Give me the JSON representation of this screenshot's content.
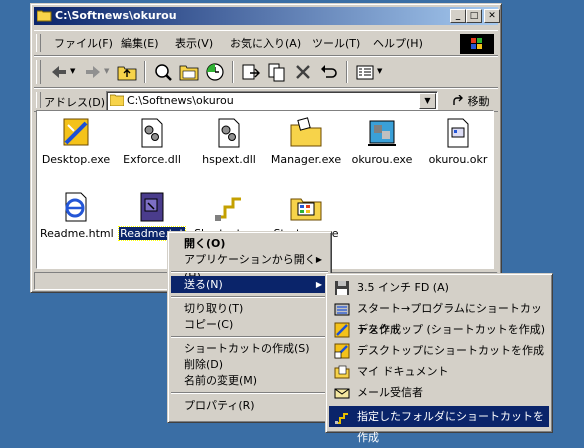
{
  "window": {
    "title": "C:\\Softnews\\okurou",
    "min_label": "_",
    "max_label": "□",
    "close_label": "✕"
  },
  "menubar": {
    "file": "ファイル(F)",
    "edit": "編集(E)",
    "view": "表示(V)",
    "favorites": "お気に入り(A)",
    "tools": "ツール(T)",
    "help": "ヘルプ(H)"
  },
  "address": {
    "label": "アドレス(D)",
    "value": "C:\\Softnews\\okurou",
    "go": "移動"
  },
  "files": [
    {
      "label": "Desktop.exe",
      "icon": "desktop-exe-icon"
    },
    {
      "label": "Exforce.dll",
      "icon": "dll-icon"
    },
    {
      "label": "hspext.dll",
      "icon": "dll-icon"
    },
    {
      "label": "Manager.exe",
      "icon": "folder-exe-icon"
    },
    {
      "label": "okurou.exe",
      "icon": "okurou-exe-icon"
    },
    {
      "label": "okurou.okr",
      "icon": "okr-file-icon"
    },
    {
      "label": "Readme.html",
      "icon": "html-icon"
    },
    {
      "label": "Readme.txt",
      "icon": "text-file-icon"
    },
    {
      "label": "Shortcut.exe",
      "icon": "shortcut-exe-icon"
    },
    {
      "label": "Startmenue",
      "icon": "startmenu-exe-icon"
    }
  ],
  "context_menu": {
    "open": "開く(O)",
    "open_with": "アプリケーションから開く(H)",
    "send_to": "送る(N)",
    "cut": "切り取り(T)",
    "copy": "コピー(C)",
    "create_shortcut": "ショートカットの作成(S)",
    "delete": "削除(D)",
    "rename": "名前の変更(M)",
    "properties": "プロパティ(R)"
  },
  "send_to_menu": [
    {
      "label": "3.5 インチ FD (A)",
      "icon": "floppy-icon"
    },
    {
      "label": "スタート→プログラムにショートカットを作成",
      "icon": "programs-icon"
    },
    {
      "label": "デスクトップ (ショートカットを作成)",
      "icon": "desktop-icon"
    },
    {
      "label": "デスクトップにショートカットを作成",
      "icon": "desktop-shortcut-icon"
    },
    {
      "label": "マイ ドキュメント",
      "icon": "my-documents-icon"
    },
    {
      "label": "メール受信者",
      "icon": "mail-icon"
    },
    {
      "label": "指定したフォルダにショートカットを作成",
      "icon": "folder-shortcut-icon"
    }
  ],
  "colors": {
    "desktop": "#3a6ea5",
    "title_active": "#0a246a",
    "face": "#d4d0c8",
    "highlight": "#0a246a"
  }
}
